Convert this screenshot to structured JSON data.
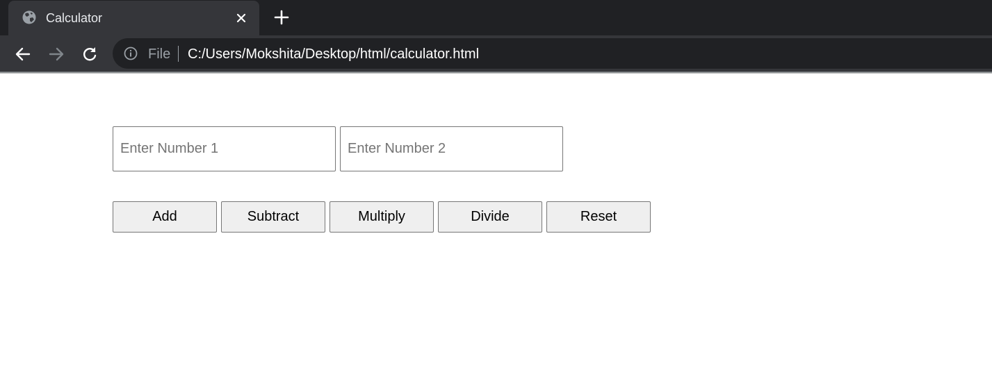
{
  "browser": {
    "tab": {
      "title": "Calculator",
      "favicon": "globe-icon",
      "close_icon": "close-icon"
    },
    "new_tab_icon": "plus-icon",
    "toolbar": {
      "back_icon": "arrow-left-icon",
      "forward_icon": "arrow-right-icon",
      "reload_icon": "reload-icon",
      "info_icon": "info-icon",
      "scheme_label": "File",
      "url": "C:/Users/Mokshita/Desktop/html/calculator.html"
    },
    "colors": {
      "tabstrip": "#202124",
      "toolbar": "#35363a",
      "omnibox": "#202124",
      "button_bg": "#efefef"
    }
  },
  "calculator": {
    "input1": {
      "placeholder": "Enter Number 1",
      "value": ""
    },
    "input2": {
      "placeholder": "Enter Number 2",
      "value": ""
    },
    "buttons": {
      "add": "Add",
      "subtract": "Subtract",
      "multiply": "Multiply",
      "divide": "Divide",
      "reset": "Reset"
    }
  }
}
